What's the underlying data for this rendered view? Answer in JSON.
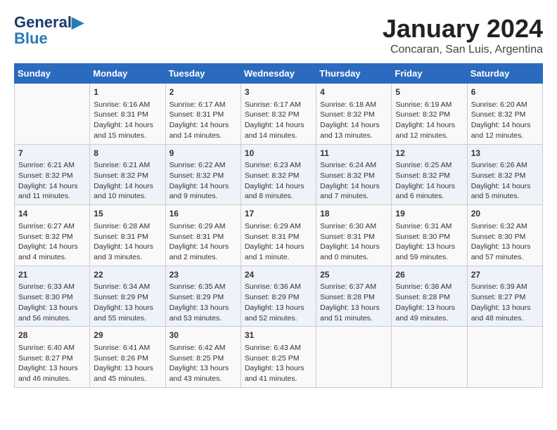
{
  "logo": {
    "line1": "General",
    "line2": "Blue"
  },
  "title": "January 2024",
  "subtitle": "Concaran, San Luis, Argentina",
  "headers": [
    "Sunday",
    "Monday",
    "Tuesday",
    "Wednesday",
    "Thursday",
    "Friday",
    "Saturday"
  ],
  "weeks": [
    [
      {
        "day": "",
        "sunrise": "",
        "sunset": "",
        "daylight": ""
      },
      {
        "day": "1",
        "sunrise": "Sunrise: 6:16 AM",
        "sunset": "Sunset: 8:31 PM",
        "daylight": "Daylight: 14 hours and 15 minutes."
      },
      {
        "day": "2",
        "sunrise": "Sunrise: 6:17 AM",
        "sunset": "Sunset: 8:31 PM",
        "daylight": "Daylight: 14 hours and 14 minutes."
      },
      {
        "day": "3",
        "sunrise": "Sunrise: 6:17 AM",
        "sunset": "Sunset: 8:32 PM",
        "daylight": "Daylight: 14 hours and 14 minutes."
      },
      {
        "day": "4",
        "sunrise": "Sunrise: 6:18 AM",
        "sunset": "Sunset: 8:32 PM",
        "daylight": "Daylight: 14 hours and 13 minutes."
      },
      {
        "day": "5",
        "sunrise": "Sunrise: 6:19 AM",
        "sunset": "Sunset: 8:32 PM",
        "daylight": "Daylight: 14 hours and 12 minutes."
      },
      {
        "day": "6",
        "sunrise": "Sunrise: 6:20 AM",
        "sunset": "Sunset: 8:32 PM",
        "daylight": "Daylight: 14 hours and 12 minutes."
      }
    ],
    [
      {
        "day": "7",
        "sunrise": "Sunrise: 6:21 AM",
        "sunset": "Sunset: 8:32 PM",
        "daylight": "Daylight: 14 hours and 11 minutes."
      },
      {
        "day": "8",
        "sunrise": "Sunrise: 6:21 AM",
        "sunset": "Sunset: 8:32 PM",
        "daylight": "Daylight: 14 hours and 10 minutes."
      },
      {
        "day": "9",
        "sunrise": "Sunrise: 6:22 AM",
        "sunset": "Sunset: 8:32 PM",
        "daylight": "Daylight: 14 hours and 9 minutes."
      },
      {
        "day": "10",
        "sunrise": "Sunrise: 6:23 AM",
        "sunset": "Sunset: 8:32 PM",
        "daylight": "Daylight: 14 hours and 8 minutes."
      },
      {
        "day": "11",
        "sunrise": "Sunrise: 6:24 AM",
        "sunset": "Sunset: 8:32 PM",
        "daylight": "Daylight: 14 hours and 7 minutes."
      },
      {
        "day": "12",
        "sunrise": "Sunrise: 6:25 AM",
        "sunset": "Sunset: 8:32 PM",
        "daylight": "Daylight: 14 hours and 6 minutes."
      },
      {
        "day": "13",
        "sunrise": "Sunrise: 6:26 AM",
        "sunset": "Sunset: 8:32 PM",
        "daylight": "Daylight: 14 hours and 5 minutes."
      }
    ],
    [
      {
        "day": "14",
        "sunrise": "Sunrise: 6:27 AM",
        "sunset": "Sunset: 8:32 PM",
        "daylight": "Daylight: 14 hours and 4 minutes."
      },
      {
        "day": "15",
        "sunrise": "Sunrise: 6:28 AM",
        "sunset": "Sunset: 8:31 PM",
        "daylight": "Daylight: 14 hours and 3 minutes."
      },
      {
        "day": "16",
        "sunrise": "Sunrise: 6:29 AM",
        "sunset": "Sunset: 8:31 PM",
        "daylight": "Daylight: 14 hours and 2 minutes."
      },
      {
        "day": "17",
        "sunrise": "Sunrise: 6:29 AM",
        "sunset": "Sunset: 8:31 PM",
        "daylight": "Daylight: 14 hours and 1 minute."
      },
      {
        "day": "18",
        "sunrise": "Sunrise: 6:30 AM",
        "sunset": "Sunset: 8:31 PM",
        "daylight": "Daylight: 14 hours and 0 minutes."
      },
      {
        "day": "19",
        "sunrise": "Sunrise: 6:31 AM",
        "sunset": "Sunset: 8:30 PM",
        "daylight": "Daylight: 13 hours and 59 minutes."
      },
      {
        "day": "20",
        "sunrise": "Sunrise: 6:32 AM",
        "sunset": "Sunset: 8:30 PM",
        "daylight": "Daylight: 13 hours and 57 minutes."
      }
    ],
    [
      {
        "day": "21",
        "sunrise": "Sunrise: 6:33 AM",
        "sunset": "Sunset: 8:30 PM",
        "daylight": "Daylight: 13 hours and 56 minutes."
      },
      {
        "day": "22",
        "sunrise": "Sunrise: 6:34 AM",
        "sunset": "Sunset: 8:29 PM",
        "daylight": "Daylight: 13 hours and 55 minutes."
      },
      {
        "day": "23",
        "sunrise": "Sunrise: 6:35 AM",
        "sunset": "Sunset: 8:29 PM",
        "daylight": "Daylight: 13 hours and 53 minutes."
      },
      {
        "day": "24",
        "sunrise": "Sunrise: 6:36 AM",
        "sunset": "Sunset: 8:29 PM",
        "daylight": "Daylight: 13 hours and 52 minutes."
      },
      {
        "day": "25",
        "sunrise": "Sunrise: 6:37 AM",
        "sunset": "Sunset: 8:28 PM",
        "daylight": "Daylight: 13 hours and 51 minutes."
      },
      {
        "day": "26",
        "sunrise": "Sunrise: 6:38 AM",
        "sunset": "Sunset: 8:28 PM",
        "daylight": "Daylight: 13 hours and 49 minutes."
      },
      {
        "day": "27",
        "sunrise": "Sunrise: 6:39 AM",
        "sunset": "Sunset: 8:27 PM",
        "daylight": "Daylight: 13 hours and 48 minutes."
      }
    ],
    [
      {
        "day": "28",
        "sunrise": "Sunrise: 6:40 AM",
        "sunset": "Sunset: 8:27 PM",
        "daylight": "Daylight: 13 hours and 46 minutes."
      },
      {
        "day": "29",
        "sunrise": "Sunrise: 6:41 AM",
        "sunset": "Sunset: 8:26 PM",
        "daylight": "Daylight: 13 hours and 45 minutes."
      },
      {
        "day": "30",
        "sunrise": "Sunrise: 6:42 AM",
        "sunset": "Sunset: 8:25 PM",
        "daylight": "Daylight: 13 hours and 43 minutes."
      },
      {
        "day": "31",
        "sunrise": "Sunrise: 6:43 AM",
        "sunset": "Sunset: 8:25 PM",
        "daylight": "Daylight: 13 hours and 41 minutes."
      },
      {
        "day": "",
        "sunrise": "",
        "sunset": "",
        "daylight": ""
      },
      {
        "day": "",
        "sunrise": "",
        "sunset": "",
        "daylight": ""
      },
      {
        "day": "",
        "sunrise": "",
        "sunset": "",
        "daylight": ""
      }
    ]
  ]
}
